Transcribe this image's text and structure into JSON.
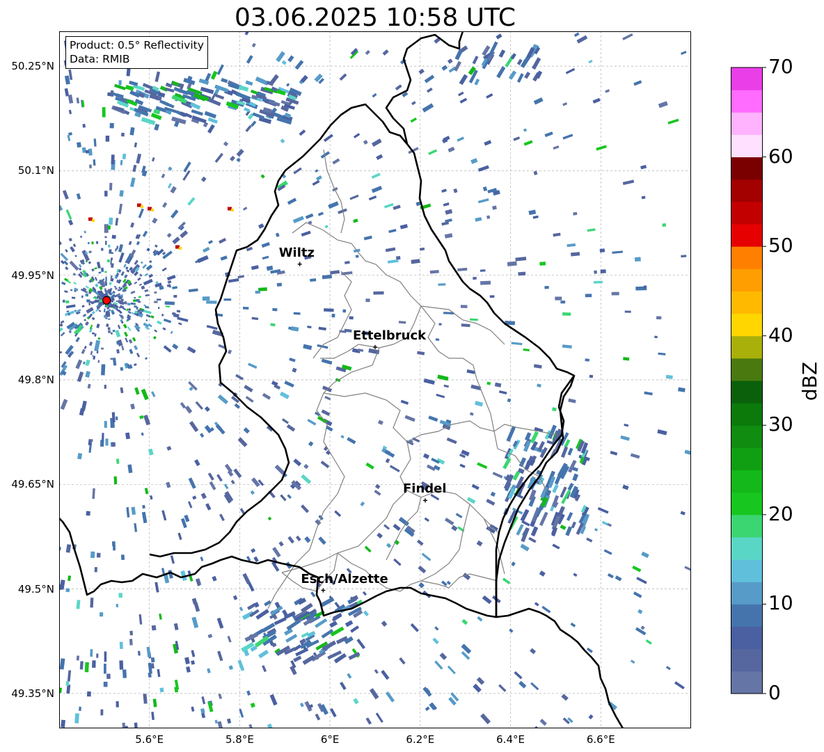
{
  "title": "03.06.2025 10:58 UTC",
  "info_box": {
    "product_line": "Product: 0.5° Reflectivity",
    "data_line": "Data: RMIB"
  },
  "axes": {
    "lon_range": [
      5.4,
      6.8
    ],
    "lat_range": [
      49.3,
      50.3
    ],
    "lon_ticks": [
      "5.6°E",
      "5.8°E",
      "6°E",
      "6.2°E",
      "6.4°E",
      "6.6°E"
    ],
    "lat_ticks": [
      "50.25°N",
      "50.1°N",
      "49.95°N",
      "49.8°N",
      "49.65°N",
      "49.5°N",
      "49.35°N"
    ],
    "grid": true
  },
  "colorbar": {
    "label": "dBZ",
    "min": 0,
    "max": 70,
    "ticks": [
      "0",
      "10",
      "20",
      "30",
      "40",
      "50",
      "60",
      "70"
    ],
    "colors": [
      "#6575a6",
      "#56679f",
      "#4a60a1",
      "#4574ad",
      "#579bc8",
      "#60c0db",
      "#5ad6c6",
      "#3bd672",
      "#17c61f",
      "#14b81a",
      "#109f12",
      "#108c10",
      "#0b7a0b",
      "#0b600b",
      "#4a7a0f",
      "#aab00a",
      "#ffd600",
      "#ffba00",
      "#ff9e00",
      "#ff8000",
      "#e60000",
      "#c30000",
      "#a30000",
      "#7a0000",
      "#ffe0ff",
      "#ffb3ff",
      "#ff6cff",
      "#ea3ee8"
    ]
  },
  "cities": [
    {
      "name": "Wiltz",
      "lon": 5.933,
      "lat": 49.966
    },
    {
      "name": "Ettelbruck",
      "lon": 6.1,
      "lat": 49.847
    },
    {
      "name": "Findel",
      "lon": 6.211,
      "lat": 49.627
    },
    {
      "name": "Esch/Alzette",
      "lon": 5.985,
      "lat": 49.498
    }
  ],
  "radar_site": {
    "lon": 5.505,
    "lat": 49.914,
    "color": "#ff0000"
  },
  "border_color": "#000000",
  "canton_color": "#808080"
}
